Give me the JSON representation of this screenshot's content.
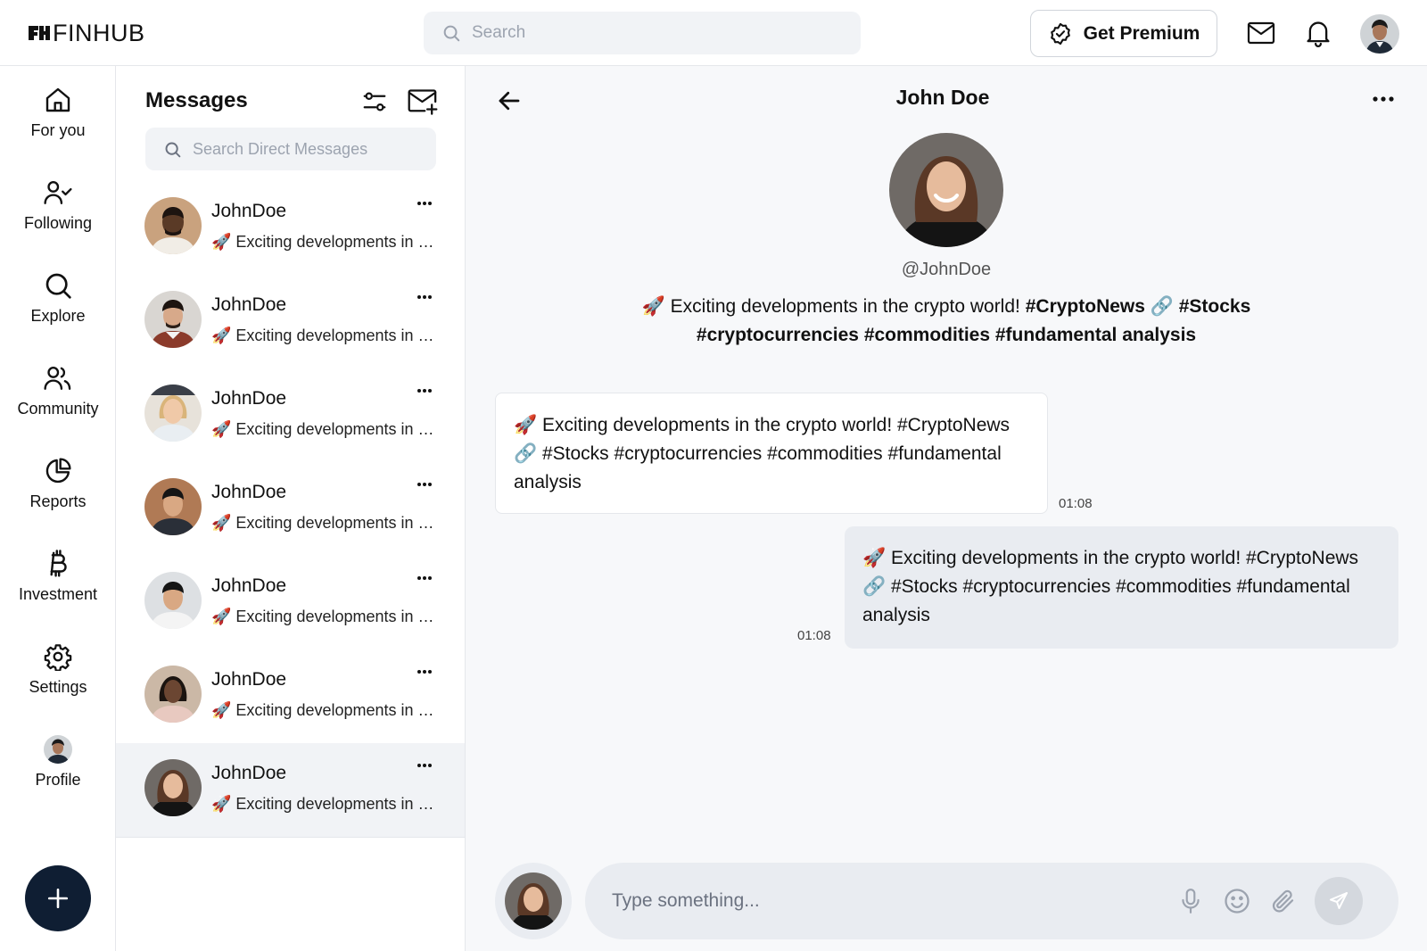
{
  "brand": {
    "name": "FINHUB"
  },
  "header": {
    "search_placeholder": "Search",
    "premium_label": "Get Premium"
  },
  "nav": {
    "items": [
      {
        "label": "For you",
        "icon": "home-icon"
      },
      {
        "label": "Following",
        "icon": "user-check-icon"
      },
      {
        "label": "Explore",
        "icon": "search-icon"
      },
      {
        "label": "Community",
        "icon": "users-icon"
      },
      {
        "label": "Reports",
        "icon": "pie-chart-icon"
      },
      {
        "label": "Investment",
        "icon": "bitcoin-icon"
      },
      {
        "label": "Settings",
        "icon": "gear-icon"
      },
      {
        "label": "Profile",
        "icon": "avatar"
      }
    ]
  },
  "messages": {
    "title": "Messages",
    "search_placeholder": "Search Direct Messages",
    "conversations": [
      {
        "name": "JohnDoe",
        "preview": "🚀 Exciting developments in the crypto world! #CryptoNews",
        "active": false
      },
      {
        "name": "JohnDoe",
        "preview": "🚀 Exciting developments in the crypto world! #CryptoNews",
        "active": false
      },
      {
        "name": "JohnDoe",
        "preview": "🚀 Exciting developments in the crypto world! #CryptoNews",
        "active": false
      },
      {
        "name": "JohnDoe",
        "preview": "🚀 Exciting developments in the crypto world! #CryptoNews",
        "active": false
      },
      {
        "name": "JohnDoe",
        "preview": "🚀 Exciting developments in the crypto world! #CryptoNews",
        "active": false
      },
      {
        "name": "JohnDoe",
        "preview": "🚀 Exciting developments in the crypto world! #CryptoNews",
        "active": false
      },
      {
        "name": "JohnDoe",
        "preview": "🚀 Exciting developments in the crypto world! #CryptoNews",
        "active": true
      }
    ]
  },
  "chat": {
    "title": "John Doe",
    "handle": "@JohnDoe",
    "bio_plain": "🚀 Exciting developments in the crypto world!",
    "bio_tags": "#CryptoNews 🔗  #Stocks #cryptocurrencies #commodities #fundamental analysis",
    "incoming": {
      "text": "🚀 Exciting developments in the crypto world! #CryptoNews 🔗  #Stocks #cryptocurrencies #commodities #fundamental analysis",
      "time": "01:08"
    },
    "outgoing": {
      "text": "🚀 Exciting developments in the crypto world! #CryptoNews 🔗  #Stocks #cryptocurrencies #commodities #fundamental analysis",
      "time": "01:08"
    },
    "composer_placeholder": "Type something..."
  },
  "colors": {
    "fab": "#0f1e33",
    "panel": "#f1f3f6",
    "outgoing_bubble": "#e9ecf1"
  }
}
